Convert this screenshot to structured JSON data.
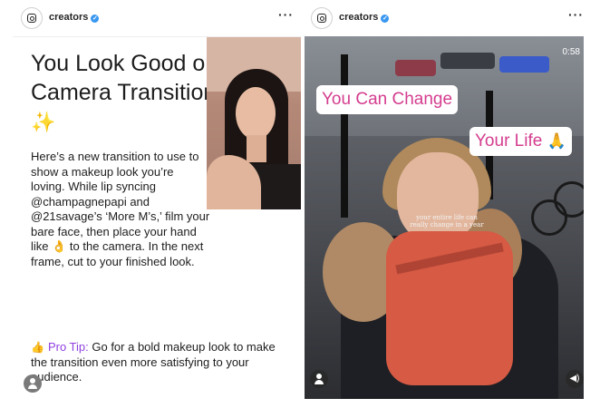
{
  "left_post": {
    "username": "creators",
    "headline": "You Look Good on Camera Transition",
    "headline_emoji": "✨",
    "body": "Here’s a new transition to use to show a makeup look you’re loving. While lip syncing @champagnepapi and @21savage’s ‘More M’s,’ film your bare face, then place your hand like 👌 to the camera. In the next frame, cut to your finished look.",
    "pro_tip_label": "Pro Tip:",
    "pro_tip_text": " Go for a bold makeup look to make the transition even more satisfying to your audience.",
    "icons": [
      "instagram-icon",
      "verified-badge-icon",
      "more-options-icon",
      "thumbs-up-icon",
      "user-icon"
    ]
  },
  "right_post": {
    "username": "creators",
    "sticker_1": "You Can Change",
    "sticker_2": "Your Life",
    "sticker_2_emoji": "🙏",
    "timer": "0:58",
    "caption_overlay": "your entire life can really change in a year",
    "icons": [
      "instagram-icon",
      "verified-badge-icon",
      "more-options-icon",
      "user-icon",
      "speaker-icon"
    ]
  },
  "colors": {
    "accent_purple": "#8f3fe0",
    "sticker_pink": "#d43d8f",
    "verified_blue": "#3897f0"
  }
}
